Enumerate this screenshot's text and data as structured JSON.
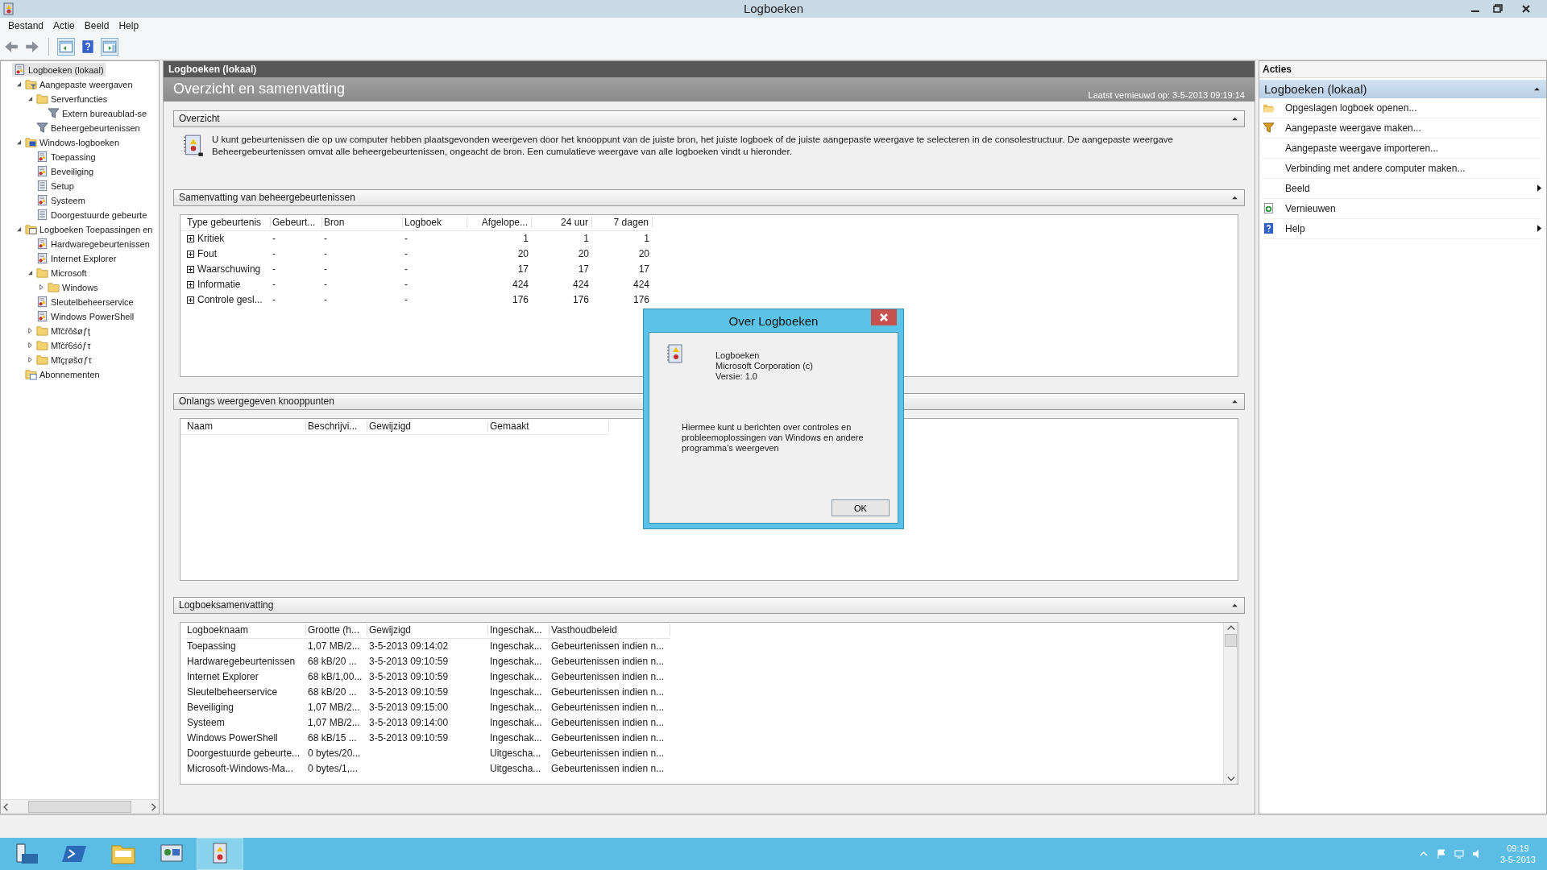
{
  "window": {
    "title": "Logboeken"
  },
  "menu": [
    "Bestand",
    "Actie",
    "Beeld",
    "Help"
  ],
  "tree": [
    {
      "label": "Logboeken (lokaal)",
      "kind": "root",
      "selected": true,
      "children": [
        {
          "label": "Aangepaste weergaven",
          "kind": "custom-folder",
          "selected": false,
          "expanded": true,
          "children": [
            {
              "label": "Serverfuncties",
              "kind": "folder",
              "selected": false,
              "expanded": true,
              "children": [
                {
                  "label": "Extern bureaublad-se",
                  "kind": "filter",
                  "selected": false
                }
              ]
            },
            {
              "label": "Beheergebeurtenissen",
              "kind": "filter",
              "selected": false
            }
          ]
        },
        {
          "label": "Windows-logboeken",
          "kind": "windows-folder",
          "selected": false,
          "expanded": true,
          "children": [
            {
              "label": "Toepassing",
              "kind": "log",
              "selected": false
            },
            {
              "label": "Beveiliging",
              "kind": "log",
              "selected": false
            },
            {
              "label": "Setup",
              "kind": "plain-log",
              "selected": false
            },
            {
              "label": "Systeem",
              "kind": "log",
              "selected": false
            },
            {
              "label": "Doorgestuurde gebeurte",
              "kind": "plain-log",
              "selected": false
            }
          ]
        },
        {
          "label": "Logboeken Toepassingen en",
          "kind": "app-folder",
          "selected": false,
          "expanded": true,
          "children": [
            {
              "label": "Hardwaregebeurtenissen",
              "kind": "log",
              "selected": false
            },
            {
              "label": "Internet Explorer",
              "kind": "log",
              "selected": false
            },
            {
              "label": "Microsoft",
              "kind": "folder",
              "selected": false,
              "expanded": true,
              "children": [
                {
                  "label": "Windows",
                  "kind": "folder",
                  "selected": false,
                  "expanded": false
                }
              ]
            },
            {
              "label": "Sleutelbeheerservice",
              "kind": "log",
              "selected": false
            },
            {
              "label": "Windows PowerShell",
              "kind": "log",
              "selected": false
            },
            {
              "label": "Mĭčŕōšøƒţ",
              "kind": "folder",
              "selected": false,
              "expanded": false
            },
            {
              "label": "Mĭčŕ6śóƒτ",
              "kind": "folder",
              "selected": false,
              "expanded": false
            },
            {
              "label": "Mĭçŗøšσƒτ",
              "kind": "folder",
              "selected": false,
              "expanded": false
            }
          ]
        },
        {
          "label": "Abonnementen",
          "kind": "subscriptions",
          "selected": false
        }
      ]
    }
  ],
  "panel_title": "Logboeken (lokaal)",
  "banner": {
    "title": "Overzicht en samenvatting",
    "refreshed": "Laatst vernieuwd op: 3-5-2013 09:19:14"
  },
  "overview": {
    "title": "Overzicht",
    "text": "U kunt gebeurtenissen die op uw computer hebben plaatsgevonden weergeven door het knooppunt van de juiste bron, het juiste logboek of de juiste aangepaste weergave te selecteren in de consolestructuur. De aangepaste weergave Beheergebeurtenissen omvat alle beheergebeurtenissen, ongeacht de bron. Een cumulatieve weergave van alle logboeken vindt u hieronder."
  },
  "summary": {
    "title": "Samenvatting van beheergebeurtenissen",
    "columns": [
      {
        "label": "Type gebeurtenis",
        "numeric": false
      },
      {
        "label": "Gebeurt...",
        "numeric": false
      },
      {
        "label": "Bron",
        "numeric": false
      },
      {
        "label": "Logboek",
        "numeric": false
      },
      {
        "label": "Afgelope...",
        "numeric": true
      },
      {
        "label": "24 uur",
        "numeric": true
      },
      {
        "label": "7 dagen",
        "numeric": true
      }
    ],
    "rows": [
      [
        "Kritiek",
        "-",
        "-",
        "-",
        "1",
        "1",
        "1"
      ],
      [
        "Fout",
        "-",
        "-",
        "-",
        "20",
        "20",
        "20"
      ],
      [
        "Waarschuwing",
        "-",
        "-",
        "-",
        "17",
        "17",
        "17"
      ],
      [
        "Informatie",
        "-",
        "-",
        "-",
        "424",
        "424",
        "424"
      ],
      [
        "Controle gesl...",
        "-",
        "-",
        "-",
        "176",
        "176",
        "176"
      ]
    ]
  },
  "recent": {
    "title": "Onlangs weergegeven knooppunten",
    "columns": [
      "Naam",
      "Beschrijvi...",
      "Gewijzigd",
      "Gemaakt"
    ]
  },
  "logs": {
    "title": "Logboeksamenvatting",
    "columns": [
      "Logboeknaam",
      "Grootte (h...",
      "Gewijzigd",
      "Ingeschak...",
      "Vasthoudbeleid"
    ],
    "rows": [
      [
        "Toepassing",
        "1,07 MB/2...",
        "3-5-2013 09:14:02",
        "Ingeschak...",
        "Gebeurtenissen indien n..."
      ],
      [
        "Hardwaregebeurtenissen",
        "68 kB/20 ...",
        "3-5-2013 09:10:59",
        "Ingeschak...",
        "Gebeurtenissen indien n..."
      ],
      [
        "Internet Explorer",
        "68 kB/1,00...",
        "3-5-2013 09:10:59",
        "Ingeschak...",
        "Gebeurtenissen indien n..."
      ],
      [
        "Sleutelbeheerservice",
        "68 kB/20 ...",
        "3-5-2013 09:10:59",
        "Ingeschak...",
        "Gebeurtenissen indien n..."
      ],
      [
        "Beveiliging",
        "1,07 MB/2...",
        "3-5-2013 09:15:00",
        "Ingeschak...",
        "Gebeurtenissen indien n..."
      ],
      [
        "Systeem",
        "1,07 MB/2...",
        "3-5-2013 09:14:00",
        "Ingeschak...",
        "Gebeurtenissen indien n..."
      ],
      [
        "Windows PowerShell",
        "68 kB/15 ...",
        "3-5-2013 09:10:59",
        "Ingeschak...",
        "Gebeurtenissen indien n..."
      ],
      [
        "Doorgestuurde gebeurte...",
        "0 bytes/20...",
        "",
        "Uitgescha...",
        "Gebeurtenissen indien n..."
      ],
      [
        "Microsoft-Windows-Ma...",
        "0 bytes/1,...",
        "",
        "Uitgescha...",
        "Gebeurtenissen indien n..."
      ]
    ]
  },
  "actions": {
    "title": "Acties",
    "section": "Logboeken (lokaal)",
    "items": [
      {
        "label": "Opgeslagen logboek openen...",
        "kind": "open-folder",
        "submenu": false
      },
      {
        "label": "Aangepaste weergave maken...",
        "kind": "filter",
        "submenu": false
      },
      {
        "label": "Aangepaste weergave importeren...",
        "kind": "none",
        "submenu": false
      },
      {
        "label": "Verbinding met andere computer maken...",
        "kind": "none",
        "submenu": false
      },
      {
        "label": "Beeld",
        "kind": "none",
        "submenu": true
      },
      {
        "label": "Vernieuwen",
        "kind": "refresh",
        "submenu": false
      },
      {
        "label": "Help",
        "kind": "help",
        "submenu": true
      }
    ]
  },
  "dialog": {
    "title": "Over Logboeken",
    "product": "Logboeken",
    "company": "Microsoft Corporation (c)",
    "version": "Versie: 1.0",
    "description": "Hiermee kunt u berichten over controles en probleemoplossingen van Windows en andere programma's weergeven",
    "ok": "OK"
  },
  "taskbar": {
    "apps": [
      {
        "kind": "server",
        "selected": false
      },
      {
        "kind": "shell",
        "selected": false
      },
      {
        "kind": "explorer",
        "selected": false
      },
      {
        "kind": "control",
        "selected": false
      },
      {
        "kind": "events",
        "selected": true
      }
    ],
    "time": "09:19",
    "date": "3-5-2013"
  }
}
